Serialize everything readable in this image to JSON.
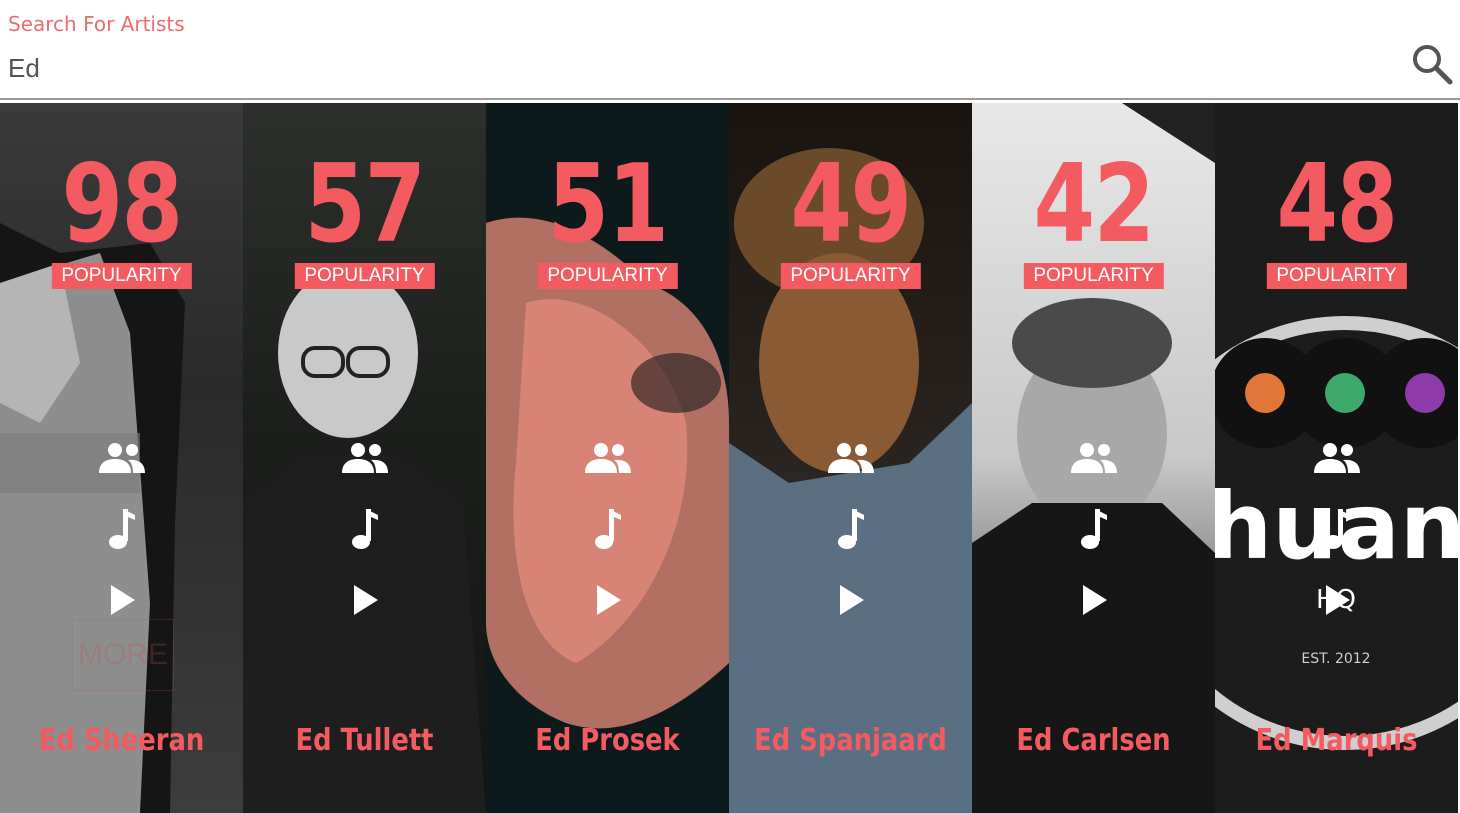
{
  "search": {
    "label": "Search For Artists",
    "value": "Ed",
    "icon": "search-icon"
  },
  "popularity_label": "POPULARITY",
  "colors": {
    "accent": "#f45b61",
    "label_text": "#ef6a6a"
  },
  "artists": [
    {
      "name": "Ed Sheeran",
      "popularity": "98",
      "popularity_label": "POPULARITY",
      "extra": "MORE"
    },
    {
      "name": "Ed Tullett",
      "popularity": "57",
      "popularity_label": "POPULARITY"
    },
    {
      "name": "Ed Prosek",
      "popularity": "51",
      "popularity_label": "POPULARITY"
    },
    {
      "name": "Ed Spanjaard",
      "popularity": "49",
      "popularity_label": "POPULARITY"
    },
    {
      "name": "Ed Carlsen",
      "popularity": "42",
      "popularity_label": "POPULARITY"
    },
    {
      "name": "Ed Marquis",
      "popularity": "48",
      "popularity_label": "POPULARITY",
      "logo_text": "huan",
      "logo_sub": "HQ",
      "logo_est": "EST. 2012"
    }
  ],
  "card_actions": [
    "followers-icon",
    "music-note-icon",
    "play-icon"
  ]
}
